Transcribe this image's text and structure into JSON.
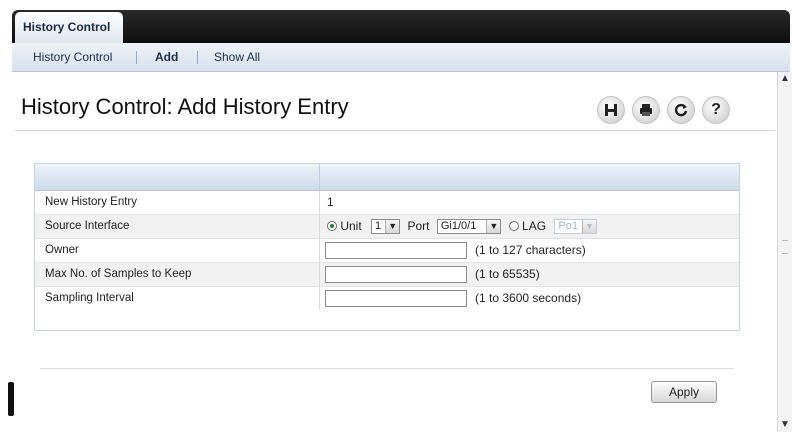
{
  "tabs": {
    "active": "History Control"
  },
  "subnav": {
    "items": [
      "History Control",
      "Add",
      "Show All"
    ]
  },
  "page": {
    "title": "History Control: Add History Entry"
  },
  "toolbar": {
    "help_glyph": "?"
  },
  "form": {
    "rows": [
      {
        "label": "New History Entry",
        "value": "1"
      },
      {
        "label": "Source Interface"
      },
      {
        "label": "Owner",
        "hint": "(1 to 127 characters)"
      },
      {
        "label": "Max No. of Samples to Keep",
        "hint": "(1 to 65535)"
      },
      {
        "label": "Sampling Interval",
        "hint": "(1 to 3600 seconds)"
      }
    ],
    "source": {
      "unit_label": "Unit",
      "unit_value": "1",
      "port_label": "Port",
      "port_value": "Gi1/0/1",
      "lag_label": "LAG",
      "lag_value": "Po1"
    }
  },
  "actions": {
    "apply_label": "Apply"
  },
  "icons": [
    "save-icon",
    "print-icon",
    "refresh-icon",
    "help-icon"
  ],
  "colors": {
    "topbar": "#111111",
    "subnav": "#dfe8f1",
    "panel_head": "#cddbea"
  }
}
